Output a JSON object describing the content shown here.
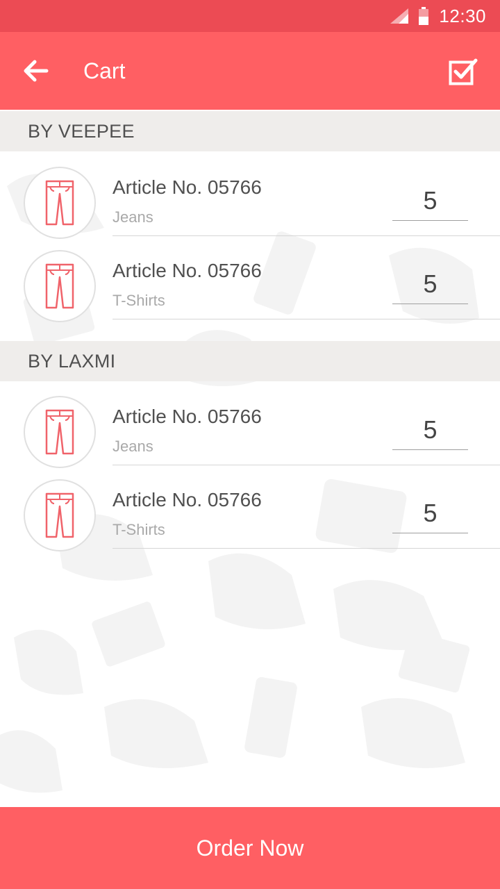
{
  "status_bar": {
    "time": "12:30"
  },
  "app_bar": {
    "title": "Cart"
  },
  "sections": [
    {
      "header": "BY VEEPEE",
      "items": [
        {
          "title": "Article No. 05766",
          "category": "Jeans",
          "quantity": "5"
        },
        {
          "title": "Article No. 05766",
          "category": "T-Shirts",
          "quantity": "5"
        }
      ]
    },
    {
      "header": "BY LAXMI",
      "items": [
        {
          "title": "Article No. 05766",
          "category": "Jeans",
          "quantity": "5"
        },
        {
          "title": "Article No. 05766",
          "category": "T-Shirts",
          "quantity": "5"
        }
      ]
    }
  ],
  "footer": {
    "order_label": "Order Now"
  },
  "colors": {
    "primary": "#ff5f63",
    "status_bar": "#ec4b54",
    "section_bg": "#efedeb"
  },
  "icons": [
    "signal-icon",
    "battery-icon",
    "back-arrow-icon",
    "check-box-icon",
    "pants-icon"
  ]
}
